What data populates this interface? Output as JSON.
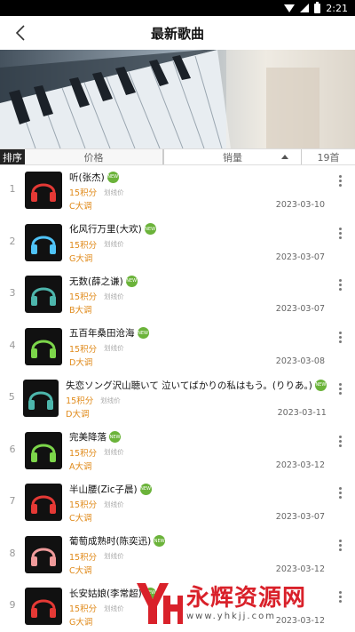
{
  "status_bar": {
    "time": "2:21"
  },
  "header": {
    "title": "最新歌曲"
  },
  "sort_bar": {
    "label": "排序",
    "price": "价格",
    "sales": "销量",
    "count": "19首"
  },
  "songs": [
    {
      "rank": "1",
      "title": "听(张杰)",
      "price": "15积分",
      "strike": "划线价",
      "key": "C大调",
      "date": "2023-03-10",
      "icon_color": "#e53935"
    },
    {
      "rank": "2",
      "title": "化风行万里(大欢)",
      "price": "15积分",
      "strike": "划线价",
      "key": "G大调",
      "date": "2023-03-07",
      "icon_color": "#4fc3f7"
    },
    {
      "rank": "3",
      "title": "无数(薛之谦)",
      "price": "15积分",
      "strike": "划线价",
      "key": "B大调",
      "date": "2023-03-07",
      "icon_color": "#4db6ac"
    },
    {
      "rank": "4",
      "title": "五百年桑田沧海",
      "price": "15积分",
      "strike": "划线价",
      "key": "D大调",
      "date": "2023-03-08",
      "icon_color": "#7cd64a"
    },
    {
      "rank": "5",
      "title": "失恋ソング沢山聴いて 泣いてばかりの私はもう。(りりあ。)",
      "price": "15积分",
      "strike": "划线价",
      "key": "D大调",
      "date": "2023-03-11",
      "icon_color": "#4db6ac"
    },
    {
      "rank": "6",
      "title": "完美降落",
      "price": "15积分",
      "strike": "划线价",
      "key": "A大调",
      "date": "2023-03-12",
      "icon_color": "#7cd64a"
    },
    {
      "rank": "7",
      "title": "半山腰(Zic子晨)",
      "price": "15积分",
      "strike": "划线价",
      "key": "C大调",
      "date": "2023-03-07",
      "icon_color": "#e53935"
    },
    {
      "rank": "8",
      "title": "葡萄成熟时(陈奕迅)",
      "price": "15积分",
      "strike": "划线价",
      "key": "C大调",
      "date": "2023-03-12",
      "icon_color": "#ef9a9a"
    },
    {
      "rank": "9",
      "title": "长安姑娘(李常超)",
      "price": "15积分",
      "strike": "划线价",
      "key": "G大调",
      "date": "2023-03-12",
      "icon_color": "#e53935"
    }
  ],
  "watermark": {
    "text": "永辉资源网",
    "url": "www.yhkjj.com"
  }
}
